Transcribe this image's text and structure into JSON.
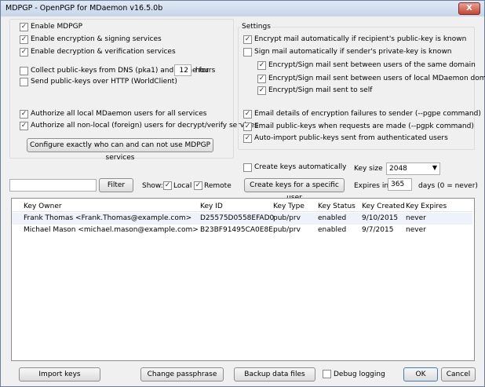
{
  "window": {
    "title": "MDPGP - OpenPGP for MDaemon v16.5.0b",
    "close_label": "X"
  },
  "left": {
    "enable_mdpgp": {
      "label": "Enable MDPGP",
      "checked": true
    },
    "enable_encryption": {
      "label": "Enable encryption & signing services",
      "checked": true
    },
    "enable_decryption": {
      "label": "Enable decryption & verification services",
      "checked": true
    },
    "collect_dns": {
      "label": "Collect public-keys from DNS (pka1) and cache for",
      "checked": false,
      "value": "12",
      "unit": "hours"
    },
    "send_http": {
      "label": "Send public-keys over HTTP (WorldClient)",
      "checked": false
    },
    "authorize_local": {
      "label": "Authorize all local MDaemon users for all services",
      "checked": true
    },
    "authorize_nonlocal": {
      "label": "Authorize all non-local (foreign) users for decrypt/verify services",
      "checked": true
    },
    "configure_button": "Configure exactly who can and can not use MDPGP services"
  },
  "settings": {
    "title": "Settings",
    "encrypt_auto": {
      "label": "Encrypt mail automatically if recipient's public-key is known",
      "checked": true
    },
    "sign_auto": {
      "label": "Sign mail automatically if sender's private-key is known",
      "checked": false
    },
    "same_domain": {
      "label": "Encrypt/Sign mail sent between users of the same domain",
      "checked": true
    },
    "local_domains": {
      "label": "Encrypt/Sign mail sent between users of local MDaemon domains",
      "checked": true
    },
    "to_self": {
      "label": "Encrypt/Sign mail sent to self",
      "checked": true
    },
    "email_failures": {
      "label": "Email details of encryption failures to sender (--pgpe command)",
      "checked": true
    },
    "email_pubkeys": {
      "label": "Email public-keys when requests are made (--pgpk command)",
      "checked": true
    },
    "auto_import": {
      "label": "Auto-import public-keys sent from authenticated users",
      "checked": true
    }
  },
  "filter": {
    "input_value": "",
    "button": "Filter",
    "show_label": "Show:",
    "local": {
      "label": "Local",
      "checked": true
    },
    "remote": {
      "label": "Remote",
      "checked": true
    }
  },
  "keys": {
    "create_auto": {
      "label": "Create keys automatically",
      "checked": false
    },
    "key_size_label": "Key size",
    "key_size_value": "2048",
    "create_specific_button": "Create keys for a specific user",
    "expires_label": "Expires in",
    "expires_value": "365",
    "expires_unit": "days (0 = never)"
  },
  "table": {
    "columns": [
      "Key Owner",
      "Key ID",
      "Key Type",
      "Key Status",
      "Key Created",
      "Key Expires"
    ],
    "rows": [
      [
        "Frank Thomas <Frank.Thomas@example.com>",
        "D25575D0558EFAD0",
        "pub/prv",
        "enabled",
        "9/10/2015",
        "never"
      ],
      [
        "Michael Mason <michael.mason@example.com>",
        "B23BF91495CA0E8E",
        "pub/prv",
        "enabled",
        "9/7/2015",
        "never"
      ]
    ]
  },
  "footer": {
    "import": "Import keys",
    "passphrase": "Change passphrase",
    "backup": "Backup data files",
    "debug": {
      "label": "Debug logging",
      "checked": false
    },
    "ok": "OK",
    "cancel": "Cancel"
  }
}
